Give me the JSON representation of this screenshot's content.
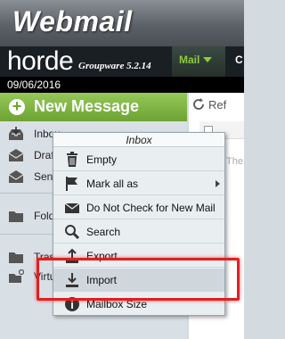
{
  "brand": {
    "webmail": "Webmail",
    "horde": "horde",
    "groupware": "Groupware 5.2.14"
  },
  "nav": {
    "mail_tab": "Mail",
    "next_tab": "C"
  },
  "date": "09/06/2016",
  "sidebar": {
    "new_message": "New Message",
    "folders": [
      {
        "label": "Inbox",
        "icon": "inbox-icon"
      },
      {
        "label": "Drafts",
        "icon": "drafts-icon"
      },
      {
        "label": "Sent",
        "icon": "sent-icon"
      },
      {
        "label": "Folders",
        "icon": "folder-icon"
      },
      {
        "label": "Trash",
        "icon": "trash-folder-icon"
      },
      {
        "label": "Virtual",
        "icon": "virtual-folder-icon"
      }
    ]
  },
  "main": {
    "refresh_label": "Ref",
    "empty_text": "The"
  },
  "context_menu": {
    "title": "Inbox",
    "items": [
      {
        "label": "Empty",
        "icon": "trash-icon"
      },
      {
        "label": "Mark all as",
        "icon": "flag-icon",
        "submenu": true
      },
      {
        "label": "Do Not Check for New Mail",
        "icon": "envelope-icon"
      },
      {
        "label": "Search",
        "icon": "search-icon"
      },
      {
        "label": "Export",
        "icon": "export-icon"
      },
      {
        "label": "Import",
        "icon": "import-icon"
      },
      {
        "label": "Mailbox Size",
        "icon": "info-icon"
      }
    ]
  },
  "colors": {
    "accent_green": "#6da332",
    "highlight": "#e02020"
  }
}
